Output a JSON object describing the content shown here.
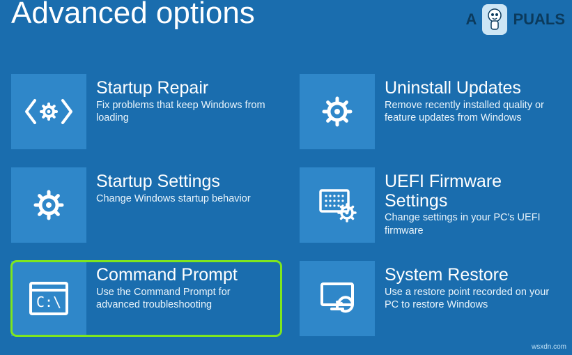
{
  "header": {
    "title": "Advanced options"
  },
  "watermark": {
    "brand_prefix": "A",
    "brand_suffix": "PUALS"
  },
  "tiles": {
    "startup_repair": {
      "title": "Startup Repair",
      "desc": "Fix problems that keep Windows from loading"
    },
    "uninstall_updates": {
      "title": "Uninstall Updates",
      "desc": "Remove recently installed quality or feature updates from Windows"
    },
    "startup_settings": {
      "title": "Startup Settings",
      "desc": "Change Windows startup behavior"
    },
    "uefi": {
      "title": "UEFI Firmware Settings",
      "desc": "Change settings in your PC's UEFI firmware"
    },
    "command_prompt": {
      "title": "Command Prompt",
      "desc": "Use the Command Prompt for advanced troubleshooting"
    },
    "system_restore": {
      "title": "System Restore",
      "desc": "Use a restore point recorded on your PC to restore Windows"
    }
  },
  "attribution": "wsxdn.com"
}
